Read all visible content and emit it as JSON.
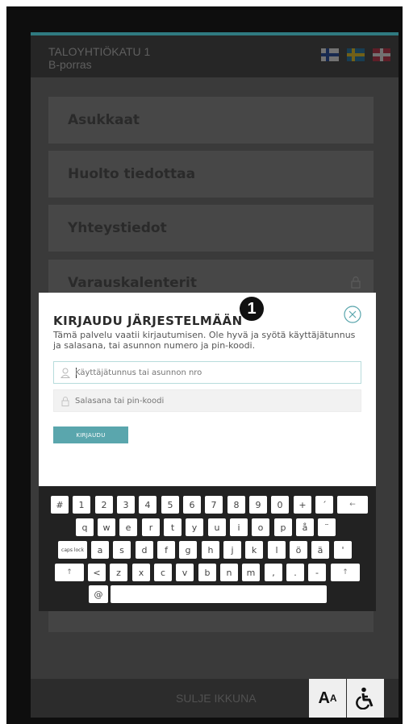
{
  "header": {
    "title_line1": "TALOYHTIÖKATU 1",
    "title_line2": "B-porras",
    "languages": [
      "fi",
      "sv",
      "en"
    ]
  },
  "menu": {
    "items": [
      {
        "label": "Asukkaat",
        "locked": false
      },
      {
        "label": "Huolto tiedottaa",
        "locked": false
      },
      {
        "label": "Yhteystiedot",
        "locked": false
      },
      {
        "label": "Varauskalenterit",
        "locked": true
      }
    ]
  },
  "dialog": {
    "title": "KIRJAUDU JÄRJESTELMÄÄN",
    "description": "Tämä palvelu vaatii kirjautumisen. Ole hyvä ja syötä käyttäjätunnus ja salasana, tai asunnon numero ja pin-koodi.",
    "username_placeholder": "Käyttäjätunnus tai asunnon nro",
    "password_placeholder": "Salasana tai pin-koodi",
    "login_label": "KIRJAUDU"
  },
  "annotation": {
    "badge": "1"
  },
  "keyboard": {
    "rows": [
      [
        "#",
        "1",
        "2",
        "3",
        "4",
        "5",
        "6",
        "7",
        "8",
        "9",
        "0",
        "+",
        "´",
        "←"
      ],
      [
        "q",
        "w",
        "e",
        "r",
        "t",
        "y",
        "u",
        "i",
        "o",
        "p",
        "å",
        "¨"
      ],
      [
        "caps lock",
        "a",
        "s",
        "d",
        "f",
        "g",
        "h",
        "j",
        "k",
        "l",
        "ö",
        "ä",
        "'"
      ],
      [
        "↑",
        "<",
        "z",
        "x",
        "c",
        "v",
        "b",
        "n",
        "m",
        ",",
        ".",
        "-",
        "↑"
      ],
      [
        "@",
        ""
      ]
    ]
  },
  "footer": {
    "close_label": "SULJE IKKUNA",
    "text_size_big": "A",
    "text_size_small": "A",
    "accessibility_icon": "wheelchair-icon"
  },
  "colors": {
    "accent": "#2f7a80",
    "login_button": "#5aa6ad",
    "overlay": "#3a3a3a"
  }
}
